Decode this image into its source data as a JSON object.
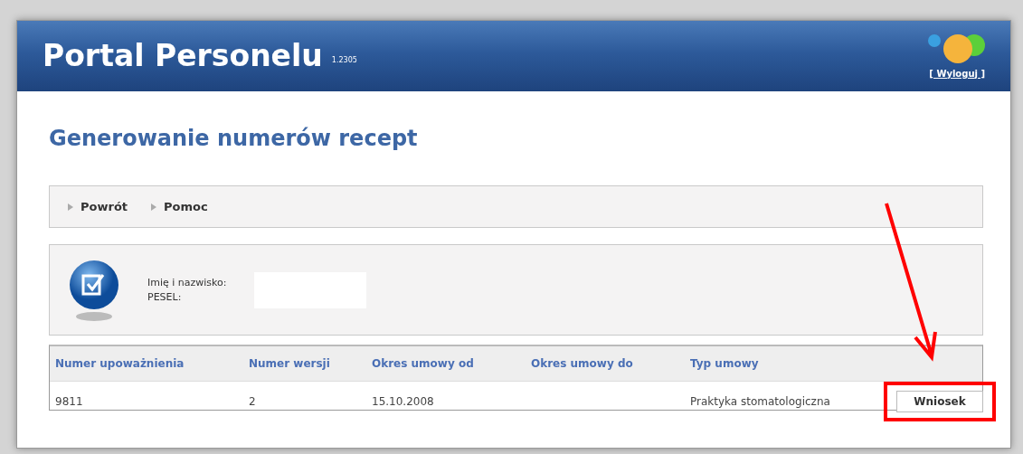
{
  "header": {
    "title": "Portal Personelu",
    "version": "1.2305",
    "logout": "[ Wyloguj ]"
  },
  "page_title": "Generowanie numerów recept",
  "nav": [
    {
      "label": "Powrót"
    },
    {
      "label": "Pomoc"
    }
  ],
  "person": {
    "labels": [
      "Imię i nazwisko:",
      "PESEL:"
    ]
  },
  "table": {
    "columns": [
      "Numer upoważnienia",
      "Numer wersji",
      "Okres umowy od",
      "Okres umowy do",
      "Typ umowy"
    ],
    "rows": [
      {
        "cells": [
          "9811",
          "2",
          "15.10.2008",
          "",
          "Praktyka stomatologiczna"
        ],
        "action": "Wniosek",
        "highlighted": true
      }
    ]
  }
}
